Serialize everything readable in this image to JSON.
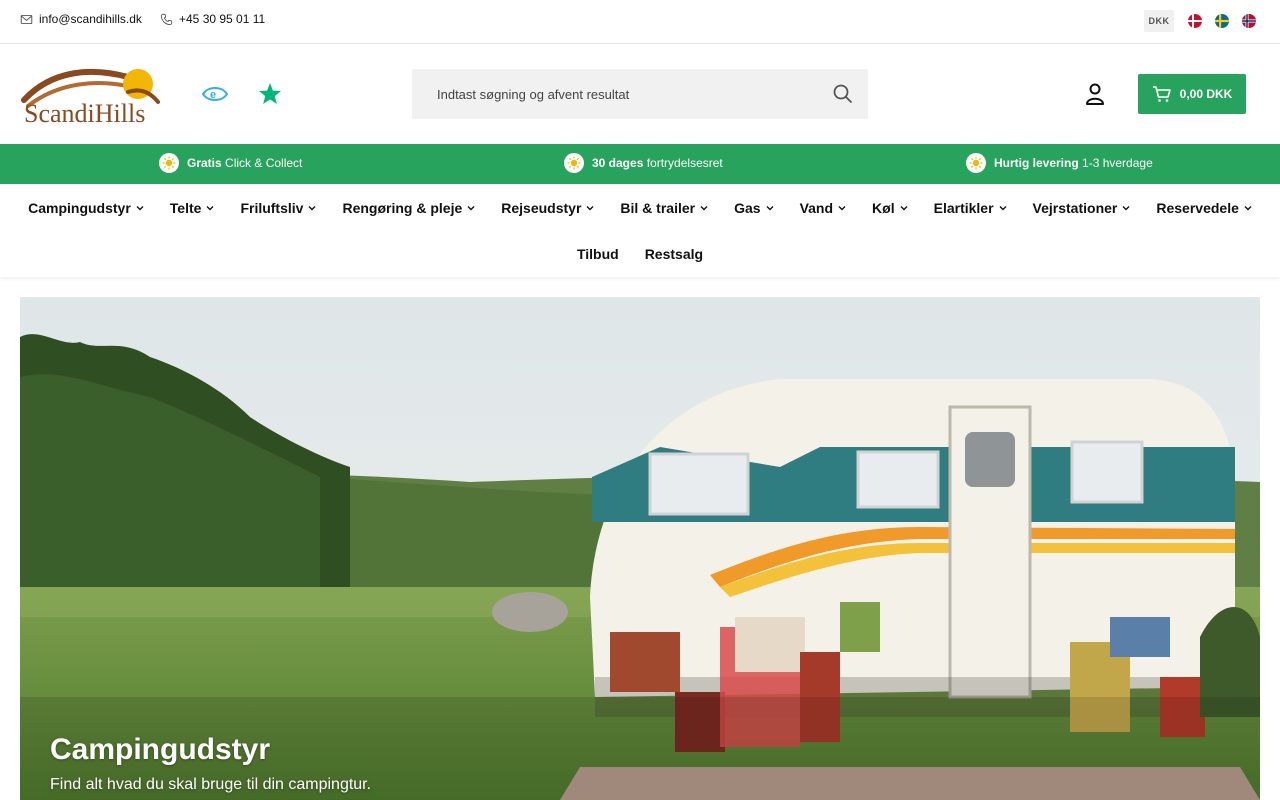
{
  "topbar": {
    "email": "info@scandihills.dk",
    "phone": "+45 30 95 01 11",
    "currency": "DKK",
    "languages": [
      "da",
      "sv",
      "no"
    ]
  },
  "header": {
    "logo_text": "ScandiHills",
    "search_placeholder": "Indtast søgning og afvent resultat",
    "cart_total": "0,00 DKK"
  },
  "usps": [
    {
      "bold": "Gratis",
      "text": "Click & Collect"
    },
    {
      "bold": "30 dages",
      "text": "fortrydelsesret"
    },
    {
      "bold": "Hurtig levering",
      "text": "1-3 hverdage"
    }
  ],
  "nav": {
    "row1": [
      "Campingudstyr",
      "Telte",
      "Friluftsliv",
      "Rengøring & pleje",
      "Rejseudstyr",
      "Bil & trailer",
      "Gas",
      "Vand",
      "Køl",
      "Elartikler",
      "Vejrstationer",
      "Reservedele"
    ],
    "row2": [
      "Tilbud",
      "Restsalg"
    ]
  },
  "hero": {
    "title": "Campingudstyr",
    "subtitle": "Find alt hvad du skal bruge til din campingtur."
  },
  "colors": {
    "brand_green": "#27a35d",
    "logo_brown": "#8a4a1f",
    "logo_sun": "#f2b705",
    "emaerket_blue": "#35aee0",
    "trustpilot_green": "#00b67a"
  }
}
